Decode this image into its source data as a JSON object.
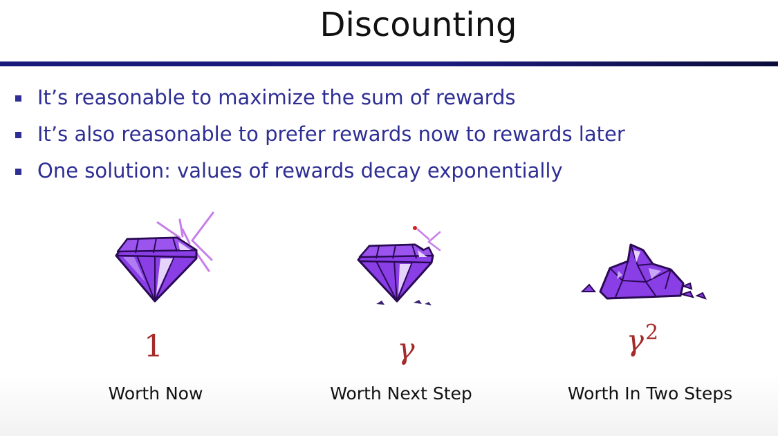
{
  "slide": {
    "title": "Discounting",
    "accent_color": "#1c1c80",
    "bullet_color": "#2e2e94",
    "value_color": "#a52a2a"
  },
  "bullets": [
    "It’s reasonable to maximize the sum of rewards",
    "It’s also reasonable to prefer rewards now to rewards later",
    "One solution: values of rewards decay exponentially"
  ],
  "illustrations": [
    {
      "icon": "sparkling-gem-icon",
      "value": "1",
      "caption": "Worth Now"
    },
    {
      "icon": "chipped-gem-icon",
      "value": "γ",
      "caption": "Worth Next Step"
    },
    {
      "icon": "crumbled-gem-icon",
      "value": "γ",
      "value_superscript": "2",
      "caption": "Worth In Two Steps"
    }
  ]
}
